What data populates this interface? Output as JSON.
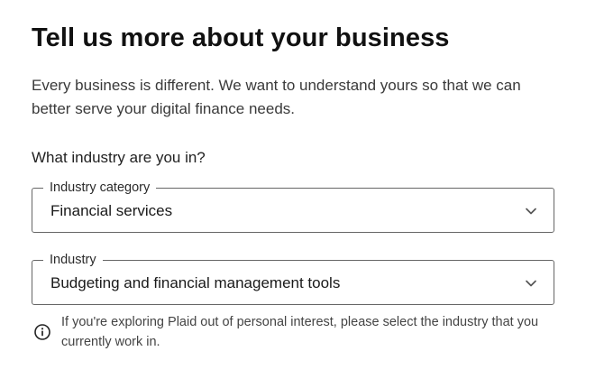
{
  "page": {
    "title": "Tell us more about your business",
    "intro": "Every business is different. We want to understand yours so that we can better serve your digital finance needs.",
    "question": "What industry are you in?"
  },
  "fields": {
    "industry_category": {
      "label": "Industry category",
      "value": "Financial services",
      "icon": "chevron-down-icon"
    },
    "industry": {
      "label": "Industry",
      "value": "Budgeting and financial management tools",
      "icon": "chevron-down-icon"
    }
  },
  "note": {
    "icon": "info-icon",
    "text": "If you're exploring Plaid out of personal interest, please select the industry that you currently work in."
  },
  "colors": {
    "text_primary": "#111111",
    "text_secondary": "#3a3a3a",
    "border": "#666666",
    "background": "#ffffff"
  }
}
